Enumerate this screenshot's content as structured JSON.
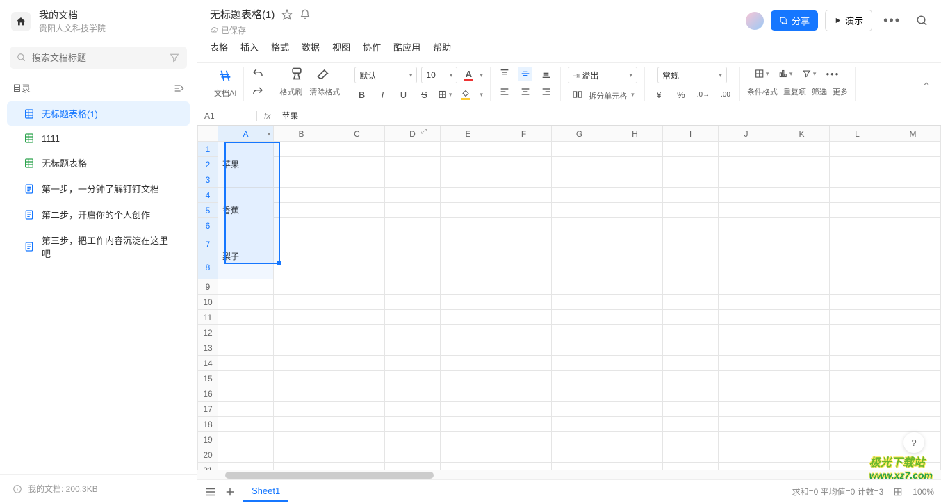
{
  "sidebar": {
    "title": "我的文档",
    "subtitle": "贵阳人文科技学院",
    "search_placeholder": "搜索文档标题",
    "dir_label": "目录",
    "items": [
      {
        "label": "无标题表格(1)",
        "type": "sheet",
        "active": true
      },
      {
        "label": "1111",
        "type": "sheet",
        "active": false
      },
      {
        "label": "无标题表格",
        "type": "sheet",
        "active": false
      },
      {
        "label": "第一步，一分钟了解钉钉文档",
        "type": "doc",
        "active": false
      },
      {
        "label": "第二步，开启你的个人创作",
        "type": "doc",
        "active": false
      },
      {
        "label": "第三步，把工作内容沉淀在这里吧",
        "type": "doc",
        "active": false
      }
    ],
    "footer": "我的文档: 200.3KB"
  },
  "header": {
    "title": "无标题表格(1)",
    "saved": "已保存",
    "share": "分享",
    "present": "演示"
  },
  "menu": [
    "表格",
    "插入",
    "格式",
    "数据",
    "视图",
    "协作",
    "酷应用",
    "帮助"
  ],
  "toolbar": {
    "docai": "文档AI",
    "fmt_painter": "格式刷",
    "clear_fmt": "清除格式",
    "font": "默认",
    "font_size": "10",
    "overflow": "溢出",
    "split_cell": "拆分单元格",
    "number_fmt": "常规",
    "cond_fmt": "条件格式",
    "dup": "重复项",
    "filter": "筛选",
    "more": "更多"
  },
  "formula": {
    "cell": "A1",
    "value": "苹果"
  },
  "sheet": {
    "columns": [
      "A",
      "B",
      "C",
      "D",
      "E",
      "F",
      "G",
      "H",
      "I",
      "J",
      "K",
      "L",
      "M"
    ],
    "rows": 22,
    "merged": [
      {
        "rowStart": 1,
        "rowEnd": 3,
        "value": "苹果"
      },
      {
        "rowStart": 4,
        "rowEnd": 6,
        "value": "香蕉"
      },
      {
        "rowStart": 7,
        "rowEnd": 8,
        "value": "梨子"
      }
    ],
    "tab": "Sheet1"
  },
  "status": {
    "sum": "求和=0 平均值=0 计数=3",
    "zoom": "100%"
  },
  "watermark": {
    "cn": "极光下载站",
    "en": "www.xz7.com"
  }
}
